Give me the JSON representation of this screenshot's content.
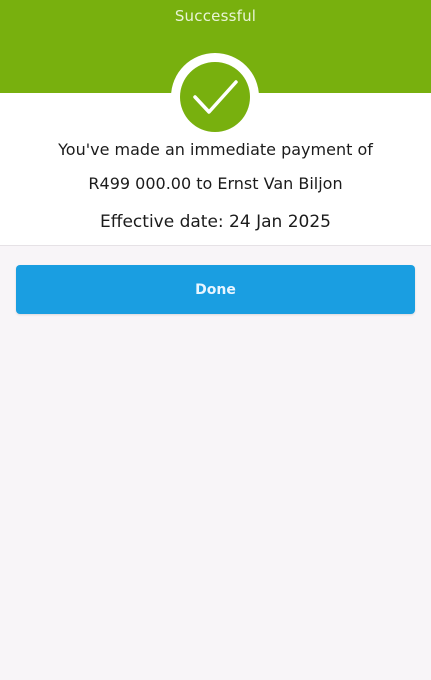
{
  "header": {
    "title": "Successful"
  },
  "confirmation": {
    "line1": "You've made an immediate payment of",
    "line2": "R499 000.00 to Ernst Van Biljon",
    "effective_date": "Effective date: 24 Jan 2025"
  },
  "actions": {
    "done_label": "Done"
  },
  "colors": {
    "header_green": "#78b00e",
    "button_blue": "#1a9ee1",
    "background": "#f8f5f8"
  },
  "icons": {
    "success": "checkmark-icon"
  }
}
